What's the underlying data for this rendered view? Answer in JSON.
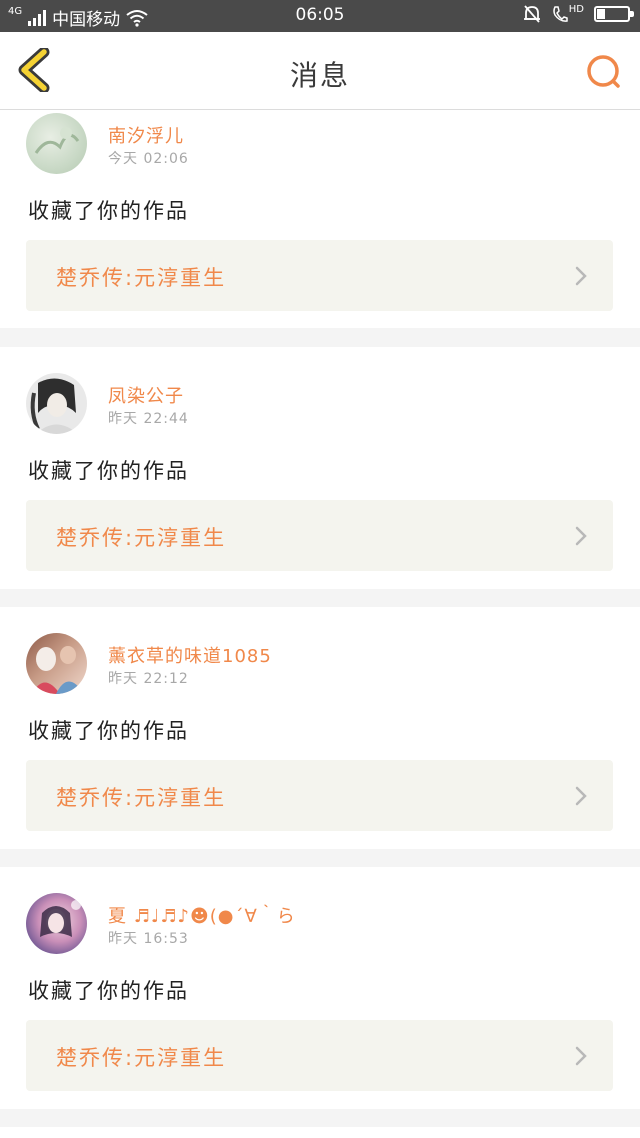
{
  "status_bar": {
    "network": "4G",
    "carrier": "中国移动",
    "time": "06:05",
    "hd_label": "HD",
    "battery_level": 0.28
  },
  "nav": {
    "title": "消息",
    "back_icon": "chevron-left-icon",
    "search_icon": "search-icon"
  },
  "colors": {
    "accent": "#f0884a",
    "back_arrow": "#f5d233",
    "card_bg": "#ffffff",
    "page_bg": "#f4f4f4",
    "work_bg": "#f4f4ee"
  },
  "messages": [
    {
      "username": "南汐浮儿",
      "time": "今天 02:06",
      "action": "收藏了你的作品",
      "work_title": "楚乔传:元淳重生"
    },
    {
      "username": "凤染公子",
      "time": "昨天 22:44",
      "action": "收藏了你的作品",
      "work_title": "楚乔传:元淳重生"
    },
    {
      "username": "薰衣草的味道1085",
      "time": "昨天 22:12",
      "action": "收藏了你的作品",
      "work_title": "楚乔传:元淳重生"
    },
    {
      "username": "夏 ♬♩♬♪☻(●´∀｀ら",
      "time": "昨天 16:53",
      "action": "收藏了你的作品",
      "work_title": "楚乔传:元淳重生"
    }
  ]
}
